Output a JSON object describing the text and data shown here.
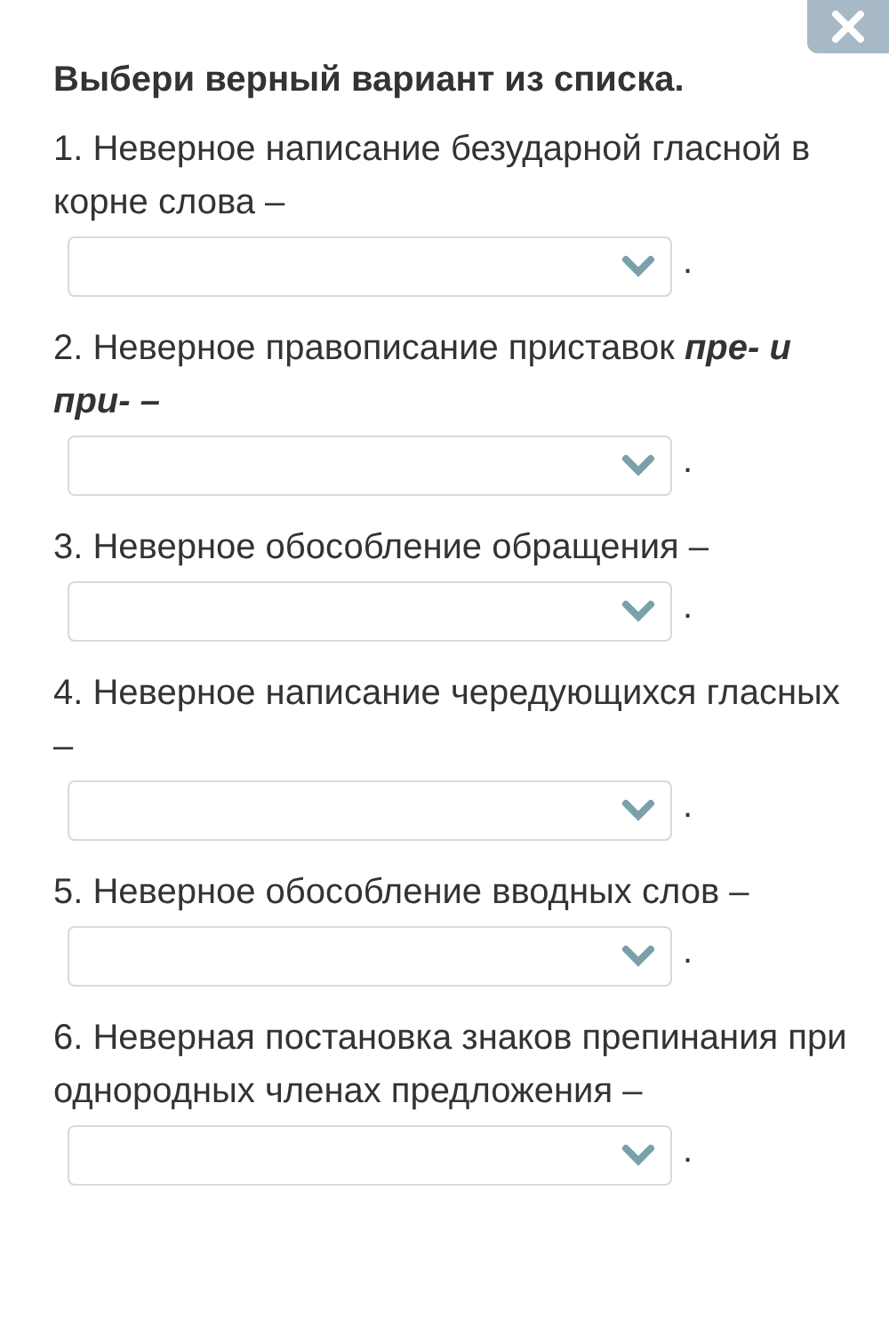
{
  "title": "Выбери верный вариант из списка.",
  "questions": [
    {
      "text": "1. Неверное написание безударной гласной в корне слова –",
      "end": "."
    },
    {
      "text": "2. Неверное правописание приставок **пре- и при- –**",
      "end": "."
    },
    {
      "text": "3. Неверное обособление обращения –",
      "end": "."
    },
    {
      "text": "4. Неверное написание чередующихся гласных –",
      "end": "."
    },
    {
      "text": "5. Неверное обособление вводных слов –",
      "end": "."
    },
    {
      "text": "6. Неверная постановка знаков препинания при однородных членах предложения –",
      "end": "."
    }
  ]
}
